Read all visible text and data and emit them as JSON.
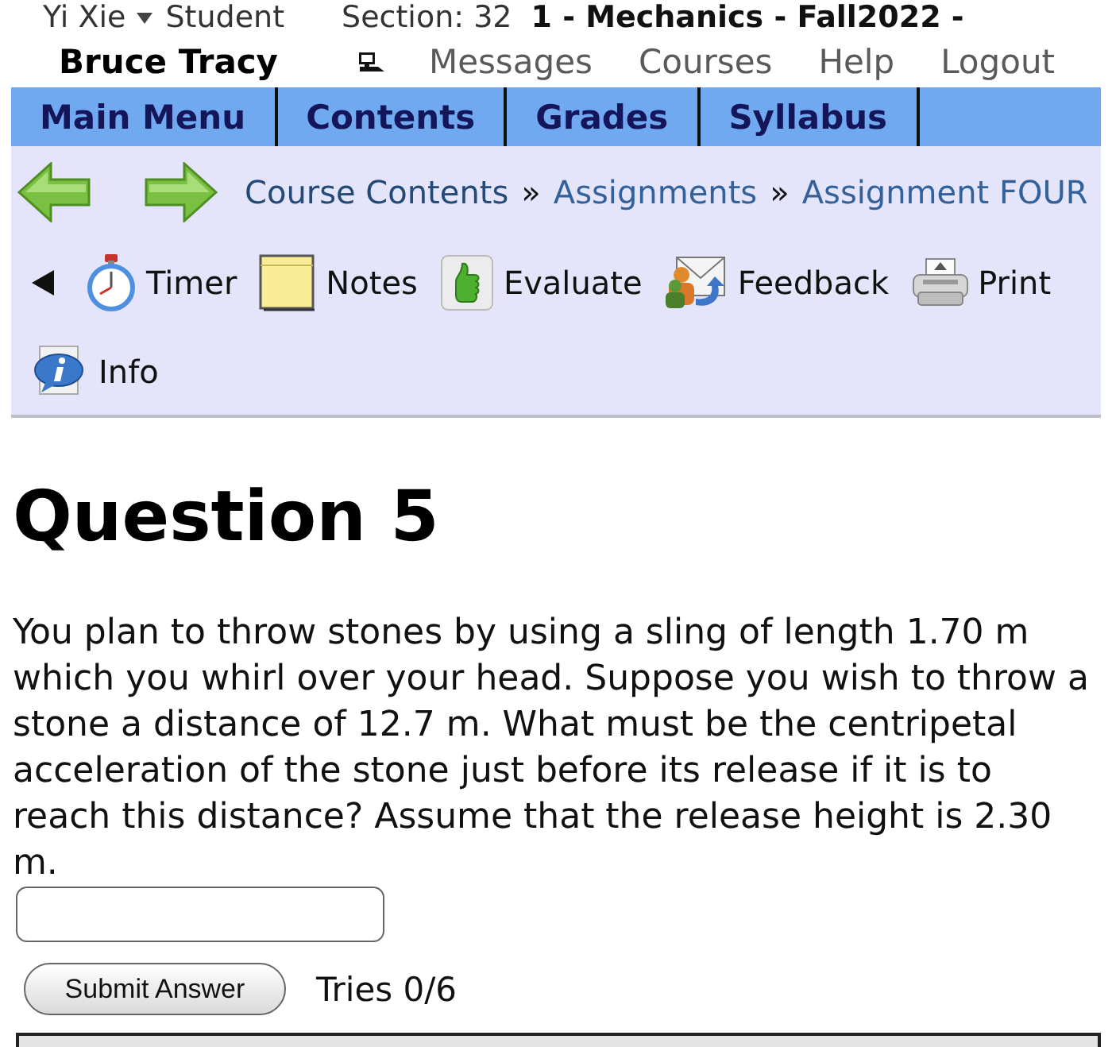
{
  "header": {
    "user": "Yi Xie",
    "role": "Student",
    "section": "Section: 32",
    "course": "1 - Mechanics - Fall2022 -"
  },
  "account_bar": {
    "name": "Bruce Tracy",
    "links": [
      "Messages",
      "Courses",
      "Help",
      "Logout"
    ]
  },
  "main_tabs": [
    {
      "label": "Main Menu"
    },
    {
      "label": "Contents"
    },
    {
      "label": "Grades"
    },
    {
      "label": "Syllabus"
    }
  ],
  "breadcrumb": [
    {
      "kind": "link",
      "label": "Course Contents"
    },
    {
      "kind": "separator",
      "label": "»"
    },
    {
      "kind": "link",
      "label": "Assignments"
    },
    {
      "kind": "separator",
      "label": "»"
    },
    {
      "kind": "link",
      "label": "Assignment FOUR"
    }
  ],
  "toolbar": [
    {
      "kind": "timer",
      "label": "Timer"
    },
    {
      "kind": "notes",
      "label": "Notes"
    },
    {
      "kind": "evaluate",
      "label": "Evaluate"
    },
    {
      "kind": "feedback",
      "label": "Feedback"
    },
    {
      "kind": "print",
      "label": "Print"
    },
    {
      "kind": "info",
      "label": "Info"
    }
  ],
  "question": {
    "title": "Question 5",
    "text": "You plan to throw stones by using a sling of length 1.70 m which you whirl over your head. Suppose you wish to throw a stone a distance of 12.7 m. What must be the centripetal acceleration of the stone just before its release if it is to reach this distance? Assume that the release height is 2.30 m.",
    "submit_label": "Submit Answer",
    "tries": "Tries 0/6"
  }
}
